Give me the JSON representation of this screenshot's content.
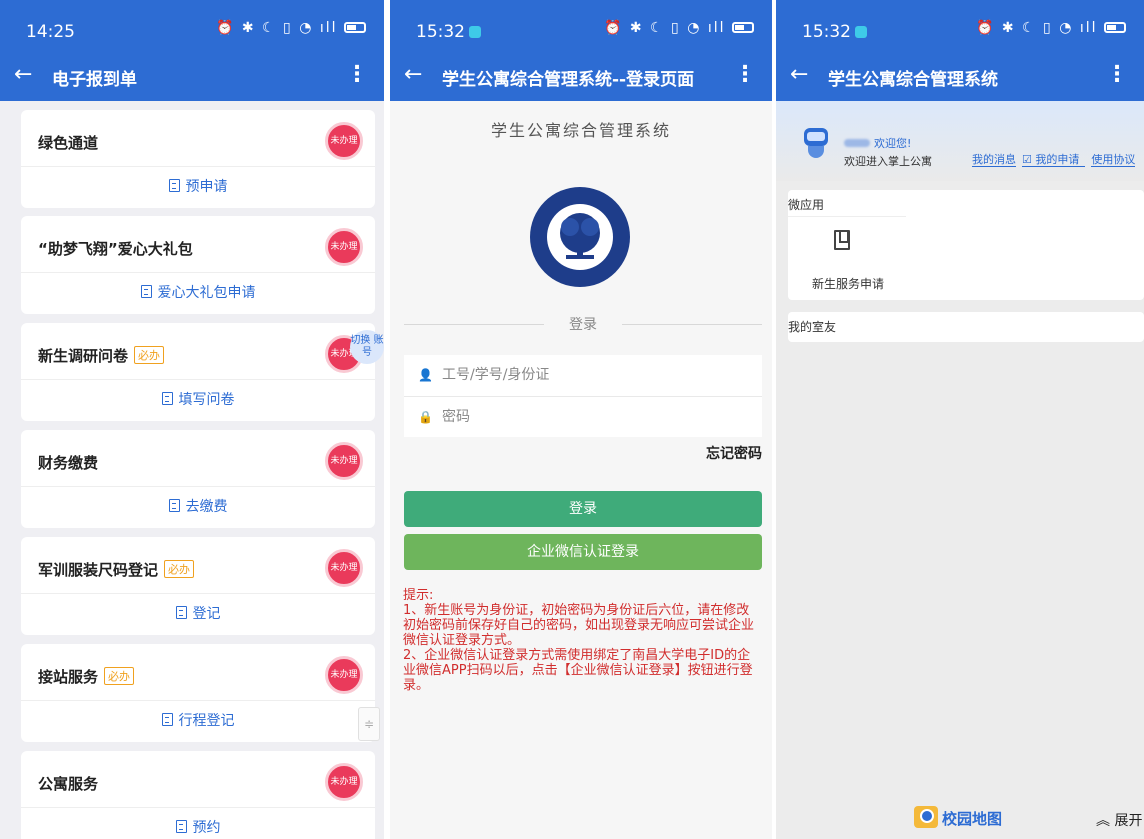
{
  "screen1": {
    "status_time": "14:25",
    "title": "电子报到单",
    "back_icon": "←",
    "more_icon": "⋮",
    "switch_account": "切换 账号",
    "scroll_handle": "≑",
    "items": [
      {
        "title": "绿色通道",
        "badge": "",
        "stamp": "未办理",
        "action": "预申请"
      },
      {
        "title": "“助梦飞翔”爱心大礼包",
        "badge": "",
        "stamp": "未办理",
        "action": "爱心大礼包申请"
      },
      {
        "title": "新生调研问卷",
        "badge": "必办",
        "stamp": "未办理",
        "action": "填写问卷"
      },
      {
        "title": "财务缴费",
        "badge": "",
        "stamp": "未办理",
        "action": "去缴费"
      },
      {
        "title": "军训服装尺码登记",
        "badge": "必办",
        "stamp": "未办理",
        "action": "登记"
      },
      {
        "title": "接站服务",
        "badge": "必办",
        "stamp": "未办理",
        "action": "行程登记"
      },
      {
        "title": "公寓服务",
        "badge": "",
        "stamp": "未办理",
        "action": "预约"
      }
    ]
  },
  "screen2": {
    "status_time": "15:32",
    "title": "学生公寓综合管理系统--登录页面",
    "system_name": "学生公寓综合管理系统",
    "login_divider": "登录",
    "username_placeholder": "工号/学号/身份证",
    "password_placeholder": "密码",
    "forgot_password": "忘记密码",
    "login_button": "登录",
    "wechat_login_button": "企业微信认证登录",
    "tips_title": "提示:",
    "tip1": "1、新生账号为身份证，初始密码为身份证后六位，请在修改初始密码前保存好自己的密码，如出现登录无响应可尝试企业微信认证登录方式。",
    "tip2": "2、企业微信认证登录方式需使用绑定了南昌大学电子ID的企业微信APP扫码以后，点击【企业微信认证登录】按钮进行登录。"
  },
  "screen3": {
    "status_time": "15:32",
    "title": "学生公寓综合管理系统",
    "welcome_greeting": "欢迎您!",
    "welcome_sub": "欢迎进入掌上公寓",
    "link_messages": "我的消息",
    "link_applications": "我的申请",
    "link_terms": "使用协议",
    "micro_apps_title": "微应用",
    "app_new_student": "新生服务申请",
    "roommates_title": "我的室友",
    "campus_map": "校园地图",
    "expand": "展开",
    "expand_icon": "︽"
  }
}
